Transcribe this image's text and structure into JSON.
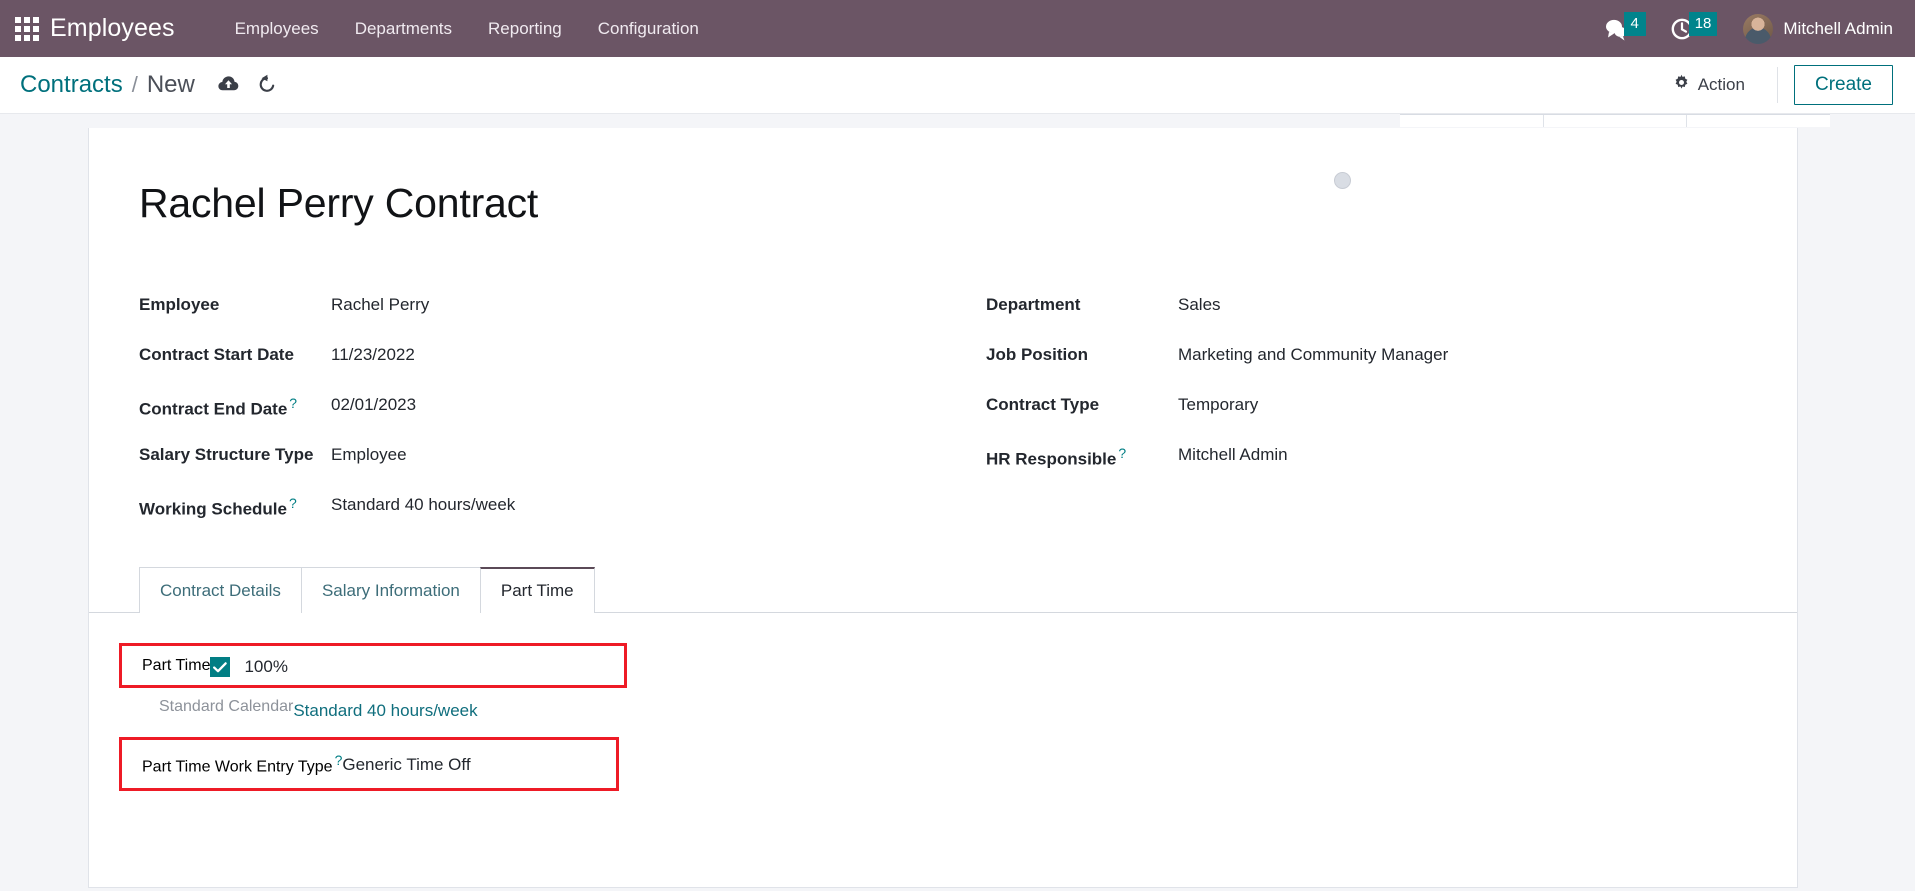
{
  "navbar": {
    "apps_icon": "apps-grid-icon",
    "brand": "Employees",
    "menu": [
      {
        "label": "Employees"
      },
      {
        "label": "Departments"
      },
      {
        "label": "Reporting"
      },
      {
        "label": "Configuration"
      }
    ],
    "messages": {
      "icon": "chat-bubble-icon",
      "count": "4"
    },
    "activities": {
      "icon": "clock-icon",
      "count": "18"
    },
    "user": {
      "name": "Mitchell Admin",
      "avatar": "user-avatar"
    }
  },
  "control_panel": {
    "breadcrumb_root": "Contracts",
    "breadcrumb_separator": "/",
    "breadcrumb_current": "New",
    "save_icon": "cloud-upload-icon",
    "discard_icon": "undo-icon",
    "action_label": "Action",
    "action_icon": "gear-icon",
    "create_label": "Create"
  },
  "form": {
    "title": "Rachel Perry Contract",
    "status_indicator": "avatar-placeholder-circle",
    "left_fields": [
      {
        "label": "Employee",
        "hint": "",
        "value": "Rachel Perry"
      },
      {
        "label": "Contract Start Date",
        "hint": "",
        "value": "11/23/2022"
      },
      {
        "label": "Contract End Date",
        "hint": "?",
        "value": "02/01/2023"
      },
      {
        "label": "Salary Structure Type",
        "hint": "",
        "value": "Employee"
      },
      {
        "label": "Working Schedule",
        "hint": "?",
        "value": "Standard 40 hours/week"
      }
    ],
    "right_fields": [
      {
        "label": "Department",
        "hint": "",
        "value": "Sales"
      },
      {
        "label": "Job Position",
        "hint": "",
        "value": "Marketing and Community Manager"
      },
      {
        "label": "Contract Type",
        "hint": "",
        "value": "Temporary"
      },
      {
        "label": "HR Responsible",
        "hint": "?",
        "value": "Mitchell Admin"
      }
    ],
    "tabs": [
      {
        "label": "Contract Details",
        "active": false
      },
      {
        "label": "Salary Information",
        "active": false
      },
      {
        "label": "Part Time",
        "active": true
      }
    ],
    "part_time_pane": {
      "part_time": {
        "label": "Part Time",
        "checkbox_checked": true,
        "checkbox_icon": "check-icon",
        "value": "100%",
        "highlighted": true
      },
      "standard_calendar": {
        "label": "Standard Calendar",
        "value": "Standard 40 hours/week",
        "highlighted": false
      },
      "part_time_work_entry_type": {
        "label": "Part Time Work Entry Type",
        "hint": "?",
        "value": "Generic Time Off",
        "highlighted": true
      }
    }
  },
  "colors": {
    "navbar": "#6b5565",
    "accent_teal": "#017e84",
    "badge_teal": "#00848c",
    "highlight_red": "#ee1b26",
    "sheet_bg": "#ffffff",
    "view_bg": "#f4f5f8"
  }
}
